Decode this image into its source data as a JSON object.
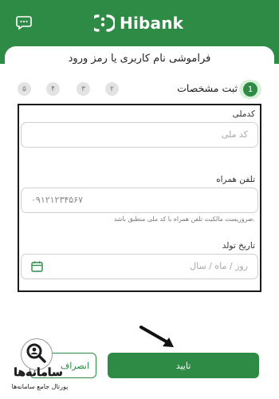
{
  "header": {
    "brand": "Hibank",
    "chat_icon": "chat-bubble-icon",
    "colors": {
      "brand_green": "#2e8b46",
      "active_step_bg": "#d9efd9"
    }
  },
  "page": {
    "title": "فراموشی نام کاربری یا رمز ورود"
  },
  "stepper": {
    "active_number": "1",
    "active_label": "ثبت مشخصات",
    "steps": [
      "۲",
      "۳",
      "۴",
      "۵"
    ]
  },
  "form": {
    "national_id": {
      "label": "کدملی",
      "placeholder": "کد ملی"
    },
    "phone": {
      "label": "تلفن همراه",
      "value": "۰۹۱۲۱۲۳۴۵۶۷",
      "hint": "ضروریست مالکیت تلفن همراه با کد ملی منطبق باشد."
    },
    "birthdate": {
      "label": "تاریخ تولد",
      "placeholder": "روز / ماه / سال",
      "icon": "calendar-icon"
    }
  },
  "actions": {
    "confirm_label": "تایید",
    "cancel_label": "انصراف"
  },
  "watermark": {
    "name": "سامانه‌ها",
    "tagline": "پورتال جامع سامانه‌ها"
  }
}
